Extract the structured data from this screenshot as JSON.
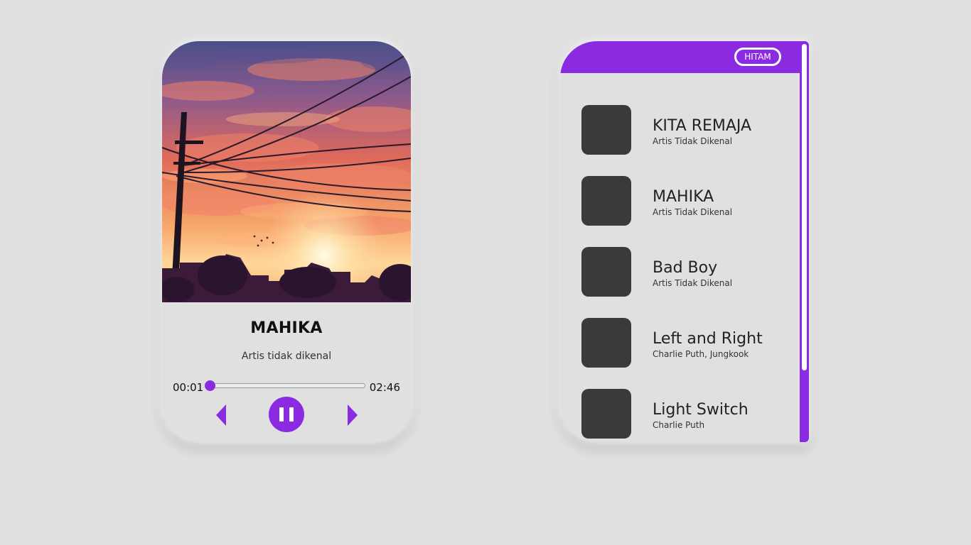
{
  "player": {
    "cover_alt": "Album art",
    "title": "MAHIKA",
    "artist": "Artis tidak dikenal",
    "current_time": "00:01",
    "duration": "02:46",
    "progress_fraction": 0.006,
    "accent_color": "#8a2be2",
    "controls": {
      "prev_icon": "triangle-left-icon",
      "play_icon": "pause-icon",
      "next_icon": "triangle-right-icon"
    }
  },
  "playlist": {
    "theme_button_label": "HITAM",
    "header_color": "#8a2be2",
    "thumb_color": "#3a3a3a",
    "items": [
      {
        "title": "KITA REMAJA",
        "artist": "Artis Tidak Dikenal"
      },
      {
        "title": "MAHIKA",
        "artist": "Artis Tidak Dikenal"
      },
      {
        "title": "Bad Boy",
        "artist": "Artis Tidak Dikenal"
      },
      {
        "title": "Left and Right",
        "artist": "Charlie Puth, Jungkook"
      },
      {
        "title": "Light Switch",
        "artist": "Charlie Puth"
      }
    ]
  }
}
